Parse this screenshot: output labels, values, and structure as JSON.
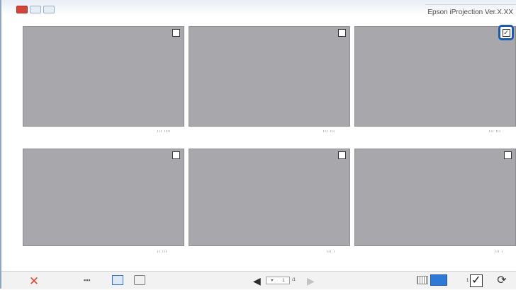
{
  "window": {
    "title": "Epson iProjection Ver.X.XX"
  },
  "thumbnails": [
    {
      "id": "thumb-1",
      "caption": "ııı ıııı",
      "checked": false
    },
    {
      "id": "thumb-2",
      "caption": "ııı ııı",
      "checked": false
    },
    {
      "id": "thumb-3",
      "caption": "ııı ııı",
      "checked": true
    },
    {
      "id": "thumb-4",
      "caption": "ıı ııı",
      "checked": false
    },
    {
      "id": "thumb-5",
      "caption": "ııı ı",
      "checked": false
    },
    {
      "id": "thumb-6",
      "caption": "ııı ı",
      "checked": false
    }
  ],
  "toolbar": {
    "delete_icon": "✕",
    "page_current": "1",
    "page_total": "/1",
    "selected_count": "1",
    "select_all_check": "✓",
    "refresh_icon": "⟳",
    "prev_icon": "◀",
    "next_icon": "▶"
  },
  "colors": {
    "thumbnail_bg": "#a8a8ac",
    "highlight": "#1a5bb0",
    "delete": "#e0452f",
    "active_layout": "#2f78d6"
  }
}
